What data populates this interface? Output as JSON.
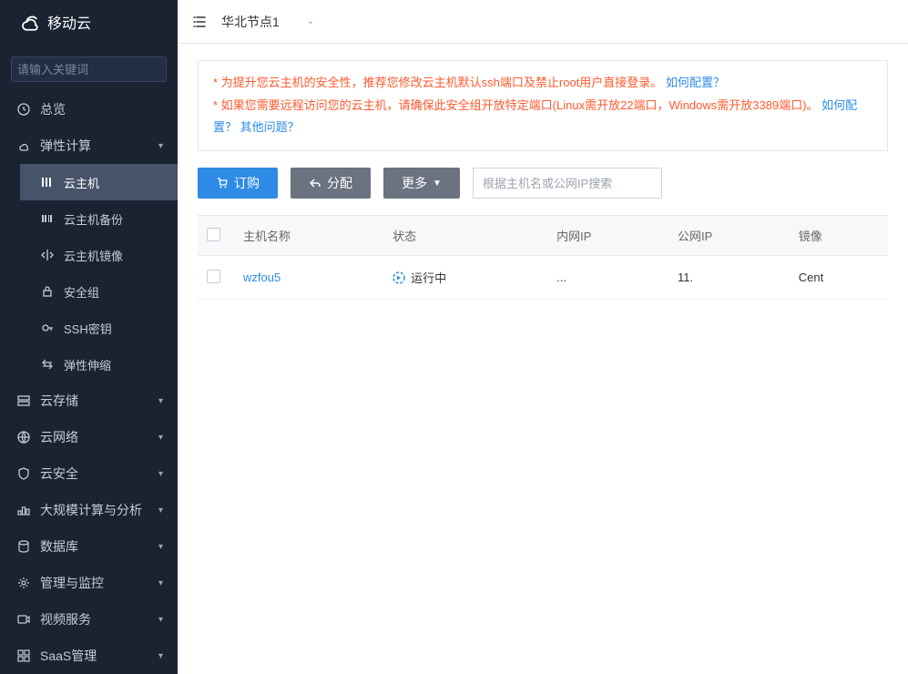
{
  "brand": "移动云",
  "search_placeholder": "请输入关键词",
  "region": "华北节点1",
  "nav": {
    "overview": "总览",
    "elastic_compute": "弹性计算",
    "elastic_items": {
      "vm": "云主机",
      "vm_backup": "云主机备份",
      "vm_image": "云主机镜像",
      "security_group": "安全组",
      "ssh_key": "SSH密钥",
      "elastic_scale": "弹性伸缩"
    },
    "storage": "云存储",
    "network": "云网络",
    "security": "云安全",
    "bigdata": "大规模计算与分析",
    "database": "数据库",
    "monitor": "管理与监控",
    "video": "视频服务",
    "saas": "SaaS管理"
  },
  "warning": {
    "line1_text": "* 为提升您云主机的安全性，推荐您修改云主机默认ssh端口及禁止root用户直接登录。",
    "line1_link": "如何配置？",
    "line2_text": "* 如果您需要远程访问您的云主机，请确保此安全组开放特定端口(Linux需开放22端口，Windows需开放3389端口)。",
    "line2_link1": "如何配置？",
    "line2_link2": "其他问题？"
  },
  "actions": {
    "order": "订购",
    "allocate": "分配",
    "more": "更多",
    "filter_placeholder": "根据主机名或公网IP搜索"
  },
  "table": {
    "headers": {
      "name": "主机名称",
      "status": "状态",
      "private_ip": "内网IP",
      "public_ip": "公网IP",
      "image": "镜像"
    },
    "rows": [
      {
        "name": "wzfou5",
        "status": "运行中",
        "private_ip": "...",
        "public_ip": "11.",
        "image": "Cent"
      }
    ]
  }
}
